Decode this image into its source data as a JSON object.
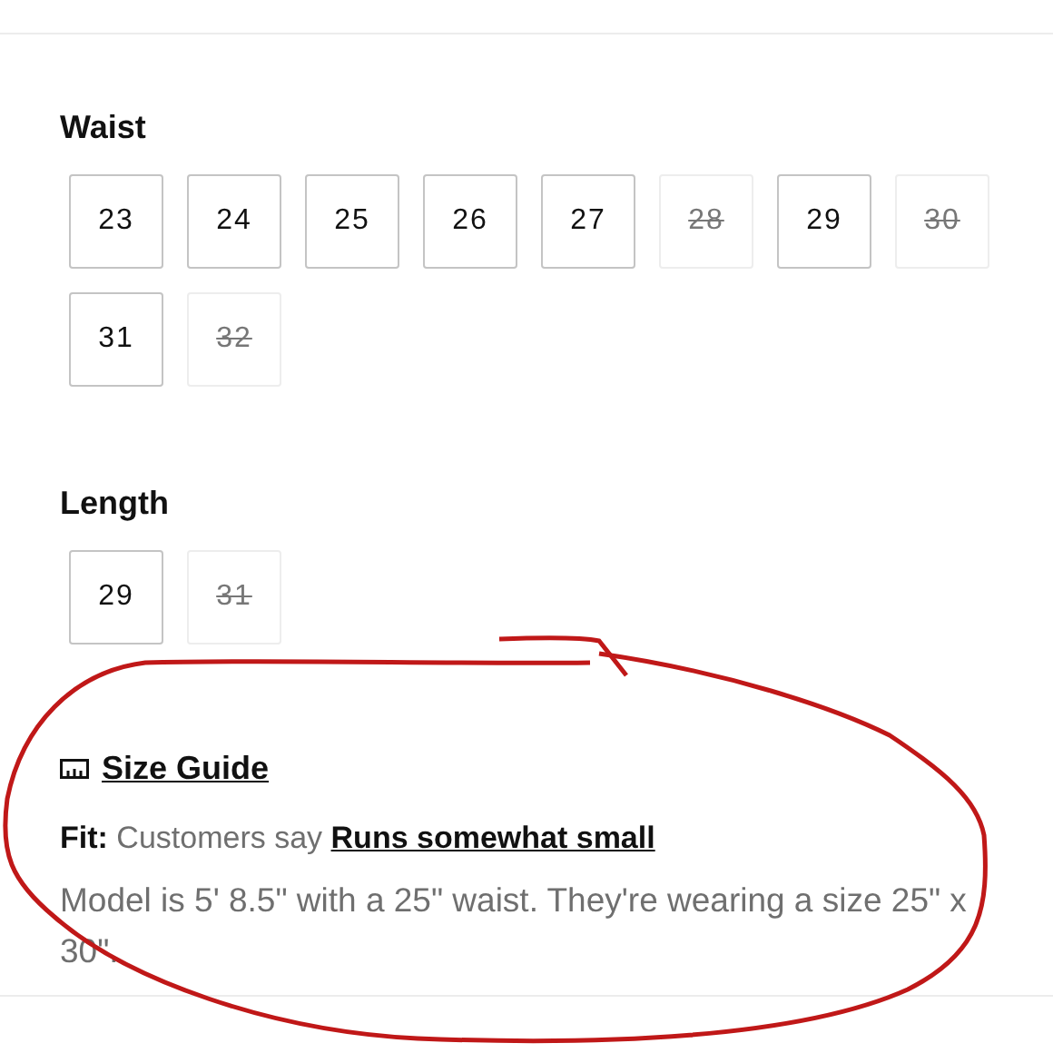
{
  "waist": {
    "title": "Waist",
    "sizes": [
      {
        "label": "23",
        "available": true
      },
      {
        "label": "24",
        "available": true
      },
      {
        "label": "25",
        "available": true
      },
      {
        "label": "26",
        "available": true
      },
      {
        "label": "27",
        "available": true
      },
      {
        "label": "28",
        "available": false
      },
      {
        "label": "29",
        "available": true
      },
      {
        "label": "30",
        "available": false
      },
      {
        "label": "31",
        "available": true
      },
      {
        "label": "32",
        "available": false
      }
    ]
  },
  "length": {
    "title": "Length",
    "sizes": [
      {
        "label": "29",
        "available": true
      },
      {
        "label": "31",
        "available": false
      }
    ]
  },
  "size_guide": {
    "label": "Size Guide"
  },
  "fit": {
    "label": "Fit:",
    "text": "Customers say",
    "link": "Runs somewhat small"
  },
  "model_note": "Model is 5' 8.5\" with a 25\" waist. They're wearing a size 25\" x 30\"."
}
